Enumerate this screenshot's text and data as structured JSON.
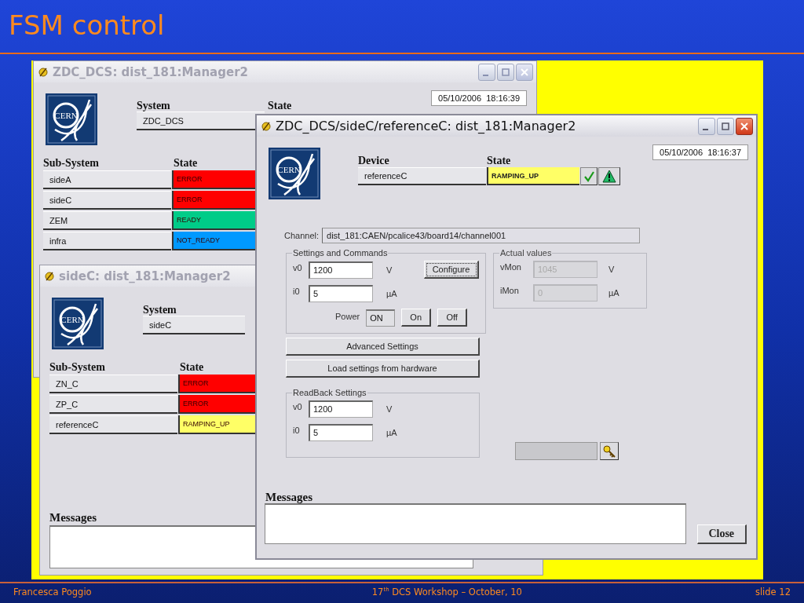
{
  "slide": {
    "title": "FSM control",
    "footer_left": "Francesca Poggio",
    "footer_center": "17$^{th}$ DCS Workshop – October, 10",
    "footer_right": "slide 12"
  },
  "windows": [
    {
      "kind": "fsm_panel",
      "active": false,
      "window_buttons": true,
      "title": "ZDC_DCS: dist_181:Manager2",
      "logo_text": "CERN",
      "system_label": "System",
      "system_value": "ZDC_DCS",
      "state_label": "State",
      "datetime": "05/10/2006  18:16:39",
      "subsystem_label": "Sub-System",
      "state_column_label": "State",
      "subsystems": [
        {
          "name": "sideA",
          "state": "ERROR",
          "color": "#ff0000"
        },
        {
          "name": "sideC",
          "state": "ERROR",
          "color": "#ff0000"
        },
        {
          "name": "ZEM",
          "state": "READY",
          "color": "#00cc88"
        },
        {
          "name": "infra",
          "state": "NOT_READY",
          "color": "#0099ff"
        }
      ]
    },
    {
      "kind": "fsm_panel",
      "active": false,
      "title": "sideC: dist_181:Manager2",
      "logo_text": "CERN",
      "system_label": "System",
      "system_value": "sideC",
      "subsystem_label": "Sub-System",
      "state_column_label": "State",
      "subsystems": [
        {
          "name": "ZN_C",
          "state": "ERROR",
          "color": "#ff0000"
        },
        {
          "name": "ZP_C",
          "state": "ERROR",
          "color": "#ff0000"
        },
        {
          "name": "referenceC",
          "state": "RAMPING_UP",
          "color": "#ffff66"
        }
      ],
      "messages_label": "Messages"
    },
    {
      "kind": "device_panel",
      "active": true,
      "window_buttons": true,
      "title": "ZDC_DCS/sideC/referenceC: dist_181:Manager2",
      "logo_text": "CERN",
      "device_label": "Device",
      "device_value": "referenceC",
      "state_label": "State",
      "state": {
        "text": "RAMPING_UP",
        "color": "#ffff66"
      },
      "datetime": "05/10/2006  18:16:37",
      "channel_label": "Channel:",
      "channel_value": "dist_181:CAEN/pcalice43/board14/channel001",
      "settings": {
        "legend": "Settings and Commands",
        "rows": [
          {
            "label": "v0",
            "value": "1200",
            "unit": "V"
          },
          {
            "label": "i0",
            "value": "5",
            "unit": "µA"
          }
        ],
        "configure": "Configure",
        "power_label": "Power",
        "power_value": "ON",
        "power_buttons": [
          "On",
          "Off"
        ]
      },
      "actual": {
        "legend": "Actual values",
        "disabled": true,
        "rows": [
          {
            "label": "vMon",
            "value": "1045",
            "unit": "V"
          },
          {
            "label": "iMon",
            "value": "0",
            "unit": "µA"
          }
        ]
      },
      "buttons": [
        "Advanced Settings",
        "Load settings from hardware"
      ],
      "readback": {
        "legend": "ReadBack Settings",
        "rows": [
          {
            "label": "v0",
            "value": "1200",
            "unit": "V"
          },
          {
            "label": "i0",
            "value": "5",
            "unit": "µA"
          }
        ]
      },
      "messages_label": "Messages",
      "close": "Close"
    }
  ]
}
